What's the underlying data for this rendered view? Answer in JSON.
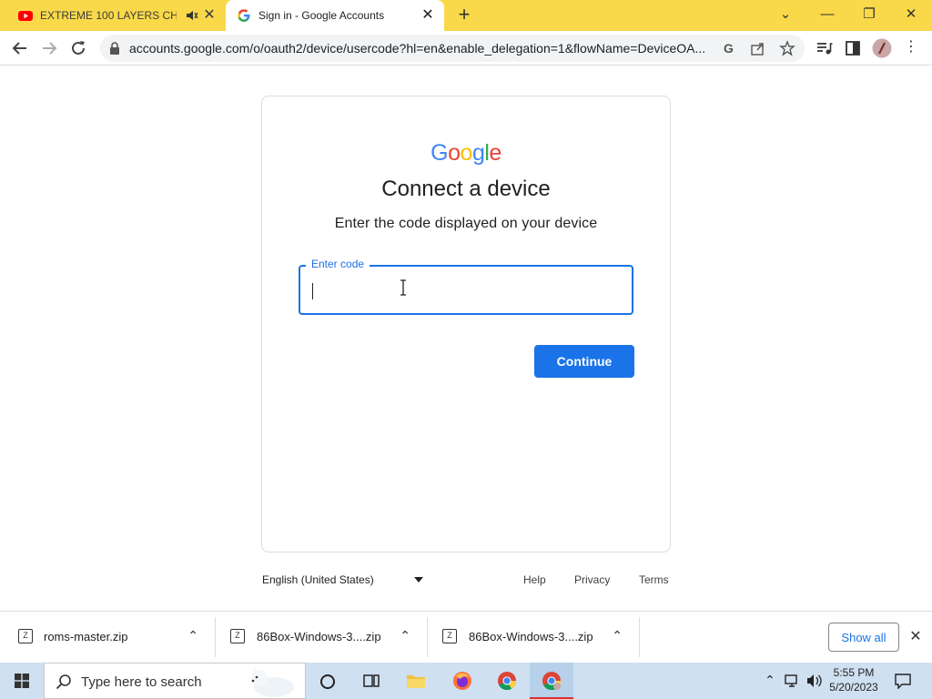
{
  "tabs": [
    {
      "title": "EXTREME 100 LAYERS CHALL",
      "muted_icon": "speaker-muted-icon",
      "close": "✕"
    },
    {
      "title": "Sign in - Google Accounts",
      "close": "✕"
    }
  ],
  "window_controls": {
    "tab_search": "⌄",
    "minimize": "—",
    "restore": "❐",
    "close": "✕"
  },
  "toolbar": {
    "url": "accounts.google.com/o/oauth2/device/usercode?hl=en&enable_delegation=1&flowName=DeviceOA..."
  },
  "page": {
    "logo": "Google",
    "heading": "Connect a device",
    "subtext": "Enter the code displayed on your device",
    "code_label": "Enter code",
    "code_value": "",
    "continue_label": "Continue"
  },
  "footer": {
    "language": "English (United States)",
    "help": "Help",
    "privacy": "Privacy",
    "terms": "Terms"
  },
  "downloads": {
    "items": [
      {
        "name": "roms-master.zip"
      },
      {
        "name": "86Box-Windows-3....zip"
      },
      {
        "name": "86Box-Windows-3....zip"
      }
    ],
    "show_all": "Show all"
  },
  "taskbar": {
    "search_placeholder": "Type here to search",
    "time": "5:55 PM",
    "date": "5/20/2023"
  },
  "colors": {
    "tabstrip": "#f9d949",
    "accent": "#1a73e8",
    "taskbar": "#cfe0f1"
  }
}
